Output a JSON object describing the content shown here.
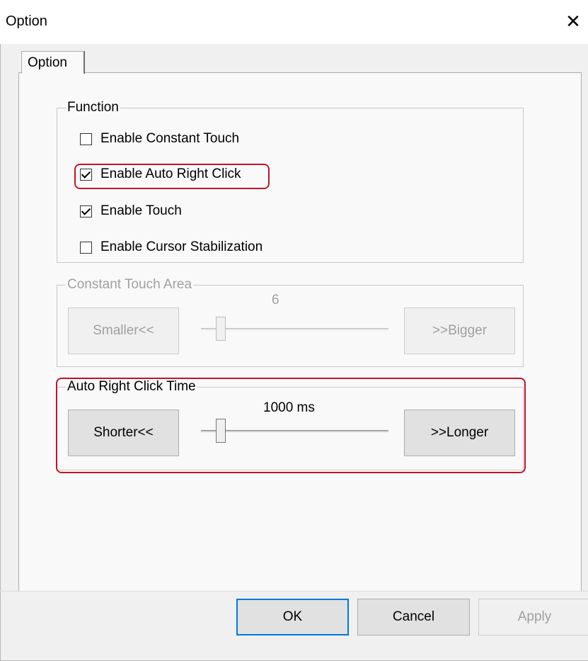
{
  "window": {
    "title": "Option"
  },
  "tabs": [
    {
      "label": "Option"
    }
  ],
  "function_group": {
    "legend": "Function",
    "options": [
      {
        "label": "Enable Constant Touch",
        "checked": false
      },
      {
        "label": "Enable Auto Right Click",
        "checked": true
      },
      {
        "label": "Enable Touch",
        "checked": true
      },
      {
        "label": "Enable Cursor Stabilization",
        "checked": false
      }
    ]
  },
  "constant_touch_area": {
    "legend": "Constant Touch Area",
    "value_label": "6",
    "smaller_label": "Smaller<<",
    "bigger_label": ">>Bigger",
    "enabled": false
  },
  "auto_right_click_time": {
    "legend": "Auto Right Click Time",
    "value_label": "1000 ms",
    "shorter_label": "Shorter<<",
    "longer_label": ">>Longer",
    "enabled": true
  },
  "footer": {
    "ok_label": "OK",
    "cancel_label": "Cancel",
    "apply_label": "Apply"
  },
  "colors": {
    "highlight": "#c0152b",
    "panel_bg": "#f9f9f9",
    "window_bg": "#f0f0f0"
  }
}
